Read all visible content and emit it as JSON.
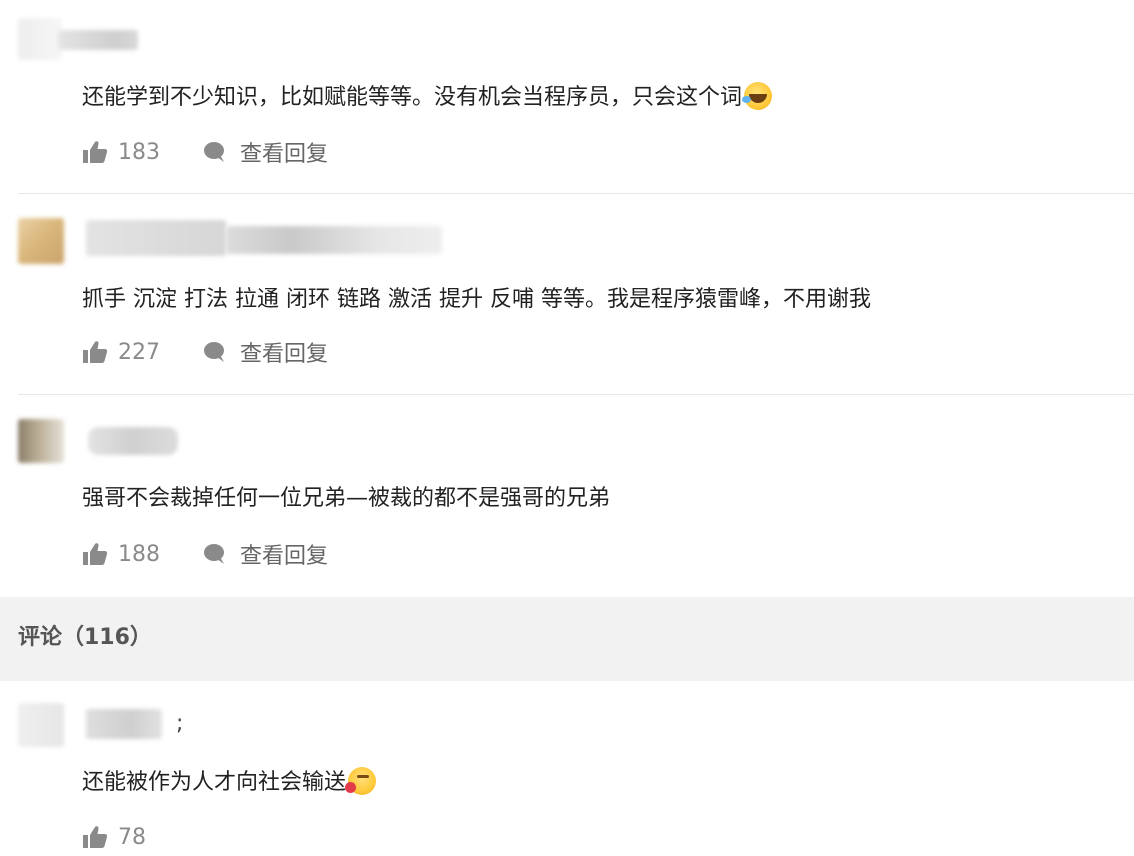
{
  "comments": [
    {
      "text": "还能学到不少知识，比如赋能等等。没有机会当程序员，只会这个词",
      "emoji": "laughing-crying-emoji",
      "likes": "183",
      "reply_label": "查看回复"
    },
    {
      "text": "抓手 沉淀 打法 拉通 闭环 链路 激活 提升 反哺 等等。我是程序猿雷峰，不用谢我",
      "likes": "227",
      "reply_label": "查看回复"
    },
    {
      "text": "强哥不会裁掉任何一位兄弟—被裁的都不是强哥的兄弟",
      "likes": "188",
      "reply_label": "查看回复"
    }
  ],
  "section": {
    "title": "评论（116）"
  },
  "latest_comment": {
    "author_suffix": ";",
    "text": "还能被作为人才向社会输送",
    "emoji": "tongue-out-emoji",
    "likes": "78"
  },
  "icons": {
    "like": "thumbs-up-icon",
    "reply": "speech-bubble-icon"
  },
  "colors": {
    "icon": "#8a8a8a",
    "section_bg": "#f2f2f2"
  }
}
